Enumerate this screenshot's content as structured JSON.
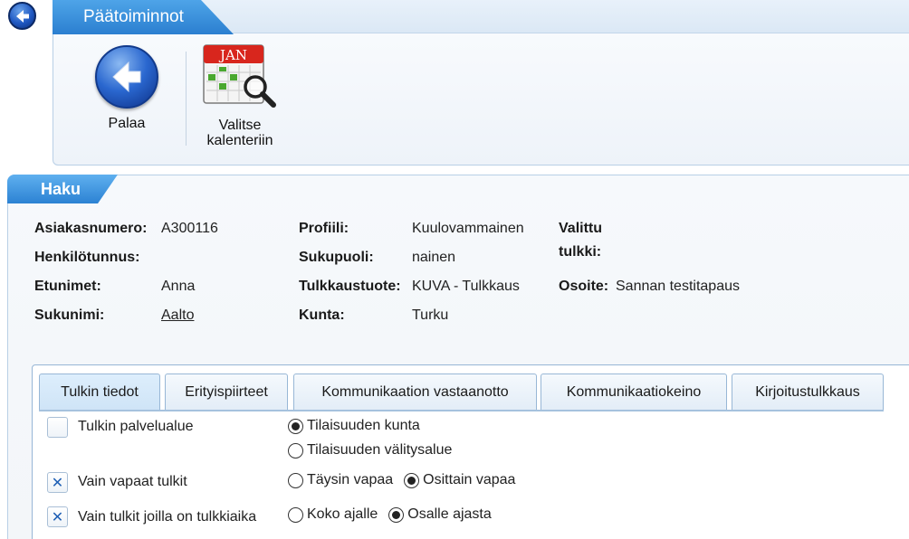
{
  "ribbon": {
    "tab_label": "Päätoiminnot",
    "back_label": "Palaa",
    "calendar_label_line1": "Valitse",
    "calendar_label_line2": "kalenteriin",
    "calendar_month": "JAN"
  },
  "haku": {
    "title": "Haku",
    "fields": {
      "asiakasnumero_label": "Asiakasnumero:",
      "asiakasnumero_value": "A300116",
      "henkilotunnus_label": "Henkilötunnus:",
      "henkilotunnus_value": "",
      "etunimet_label": "Etunimet:",
      "etunimet_value": "Anna",
      "sukunimi_label": "Sukunimi:",
      "sukunimi_value": "Aalto",
      "profiili_label": "Profiili:",
      "profiili_value": "Kuulovammainen",
      "sukupuoli_label": "Sukupuoli:",
      "sukupuoli_value": "nainen",
      "tulkkaustuote_label": "Tulkkaustuote:",
      "tulkkaustuote_value": "KUVA - Tulkkaus",
      "kunta_label": "Kunta:",
      "kunta_value": "Turku",
      "valittu_tulkki_label_line1": "Valittu",
      "valittu_tulkki_label_line2": "tulkki:",
      "osoite_label": "Osoite:",
      "osoite_value": "Sannan testitapaus"
    }
  },
  "tabs": [
    {
      "label": "Tulkin tiedot",
      "active": true
    },
    {
      "label": "Erityispiirteet",
      "active": false
    },
    {
      "label": "Kommunikaation vastaanotto",
      "active": false
    },
    {
      "label": "Kommunikaatiokeino",
      "active": false
    },
    {
      "label": "Kirjoitustulkkaus",
      "active": false
    }
  ],
  "filters": {
    "palvelualue": {
      "label": "Tulkin palvelualue",
      "checked": false,
      "option1": "Tilaisuuden kunta",
      "option2": "Tilaisuuden välitysalue",
      "selected": "Tilaisuuden kunta"
    },
    "vapaat": {
      "label": "Vain vapaat tulkit",
      "checked": true,
      "option1": "Täysin vapaa",
      "option2": "Osittain vapaa",
      "selected": "Osittain vapaa"
    },
    "tulkkiaika": {
      "label": "Vain tulkit joilla on tulkkiaika",
      "checked": true,
      "option1": "Koko ajalle",
      "option2": "Osalle ajasta",
      "selected": "Osalle ajasta"
    },
    "check_mark": "✕"
  },
  "colors": {
    "accent": "#2b7fd0",
    "panel_border": "#b8cfe6"
  }
}
